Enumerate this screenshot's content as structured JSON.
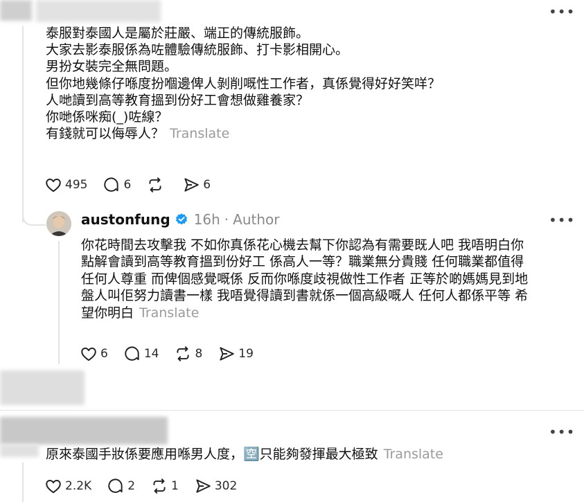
{
  "comment1": {
    "lines": [
      "泰服對泰國人是屬於莊嚴、端正的傳統服飾。",
      "大家去影泰服係為咗體驗傳統服飾、打卡影相開心。",
      "男扮女裝完全無問題。",
      "但你地幾條仔喺度扮嗰邊俾人剝削嘅性工作者，真係覺得好好笑咩？",
      "人哋讀到高等教育搵到份好工會想做雞養家？",
      "你哋係咪痴(_)咗線？",
      "有錢就可以侮辱人？"
    ],
    "translate": "Translate",
    "likes": "495",
    "replies": "6",
    "reposts": "",
    "shares": "6"
  },
  "reply": {
    "username": "austonfung",
    "time": "16h",
    "sep": "·",
    "author_badge": "Author",
    "verified_icon": "verified-badge-icon",
    "lines": [
      "你花時間去攻擊我 不如你真係花心機去幫下你認為有需要既人吧 我唔明白你",
      "點解會讀到高等教育搵到份好工 係高人一等？職業無分貴賤 任何職業都值得",
      "任何人尊重 而俾個感覺嘅係 反而你喺度歧視做性工作者 正等於啲媽媽見到地",
      "盤人叫佢努力讀書一樣 我唔覺得讀到書就係一個高級嘅人 任何人都係平等 希",
      "望你明白"
    ],
    "translate": "Translate",
    "likes": "6",
    "replies": "14",
    "reposts": "8",
    "shares": "19"
  },
  "comment2": {
    "text": "原來泰國手妝係要應用喺男人度，🈳只能夠發揮最大極致",
    "translate": "Translate",
    "likes": "2.2K",
    "replies": "2",
    "reposts": "1",
    "shares": "302"
  },
  "more_label": "•••",
  "icons": {
    "like": "heart-icon",
    "reply": "comment-icon",
    "repost": "repost-icon",
    "share": "share-icon"
  },
  "colors": {
    "verified": "#1d9bf0",
    "muted": "#8a8a8a",
    "text": "#111111"
  }
}
